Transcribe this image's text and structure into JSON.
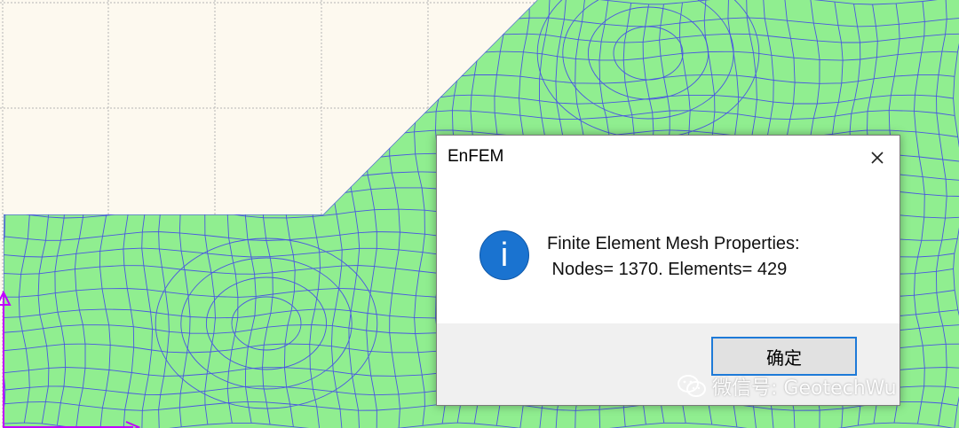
{
  "canvas": {
    "background_color": "#fdf9ef",
    "mesh_fill_color": "#90ee90",
    "mesh_line_color": "#4a57e0",
    "grid_line_color": "#b5b5b5",
    "axis_color": "#c000ff"
  },
  "dialog": {
    "title": "EnFEM",
    "close_icon": "close-icon",
    "icon": "info-icon",
    "icon_glyph": "i",
    "message_line1": "Finite Element Mesh Properties:",
    "message_line2": " Nodes= 1370. Elements= 429",
    "ok_label": "确定"
  },
  "watermark": {
    "text": "微信号: GeotechWu",
    "icon": "wechat-icon"
  }
}
